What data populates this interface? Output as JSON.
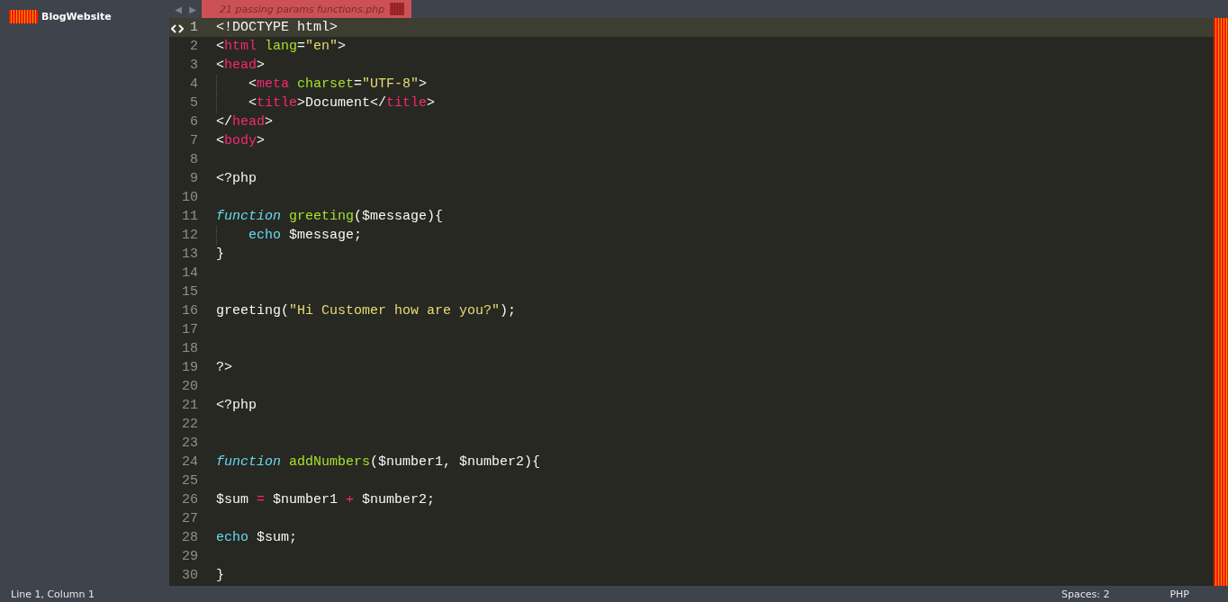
{
  "sidebar": {
    "folders": [
      {
        "name": "BlogWebsite"
      }
    ]
  },
  "tab_bar": {
    "nav": [
      "◀",
      "▶"
    ],
    "tabs": [
      {
        "label": "21 passing params functions.php",
        "selected": true
      }
    ]
  },
  "editor": {
    "lines": [
      {
        "number": "1",
        "current": true,
        "indented": false,
        "tokens": [
          {
            "kind": "plain",
            "text": "<!DOCTYPE html>"
          }
        ]
      },
      {
        "number": "2",
        "current": false,
        "indented": false,
        "tokens": [
          {
            "kind": "plain",
            "text": "<"
          },
          {
            "kind": "tag",
            "text": "html "
          },
          {
            "kind": "attr",
            "text": "lang"
          },
          {
            "kind": "plain",
            "text": "="
          },
          {
            "kind": "string",
            "text": "\"en\""
          },
          {
            "kind": "plain",
            "text": ">"
          }
        ]
      },
      {
        "number": "3",
        "current": false,
        "indented": false,
        "tokens": [
          {
            "kind": "plain",
            "text": "<"
          },
          {
            "kind": "tag",
            "text": "head"
          },
          {
            "kind": "plain",
            "text": ">"
          }
        ]
      },
      {
        "number": "4",
        "current": false,
        "indented": true,
        "tokens": [
          {
            "kind": "plain",
            "text": "<"
          },
          {
            "kind": "tag",
            "text": "meta "
          },
          {
            "kind": "attr",
            "text": "charset"
          },
          {
            "kind": "plain",
            "text": "="
          },
          {
            "kind": "string",
            "text": "\"UTF-8\""
          },
          {
            "kind": "plain",
            "text": ">"
          }
        ]
      },
      {
        "number": "5",
        "current": false,
        "indented": true,
        "tokens": [
          {
            "kind": "plain",
            "text": "<"
          },
          {
            "kind": "tag",
            "text": "title"
          },
          {
            "kind": "plain",
            "text": ">Document</"
          },
          {
            "kind": "tag",
            "text": "title"
          },
          {
            "kind": "plain",
            "text": ">"
          }
        ]
      },
      {
        "number": "6",
        "current": false,
        "indented": false,
        "tokens": [
          {
            "kind": "plain",
            "text": "</"
          },
          {
            "kind": "tag",
            "text": "head"
          },
          {
            "kind": "plain",
            "text": ">"
          }
        ]
      },
      {
        "number": "7",
        "current": false,
        "indented": false,
        "tokens": [
          {
            "kind": "plain",
            "text": "<"
          },
          {
            "kind": "tag",
            "text": "body"
          },
          {
            "kind": "plain",
            "text": ">"
          }
        ]
      },
      {
        "number": "8",
        "current": false,
        "indented": false
      },
      {
        "number": "9",
        "current": false,
        "indented": false,
        "tokens": [
          {
            "kind": "plain",
            "text": "<?php"
          }
        ]
      },
      {
        "number": "10",
        "current": false,
        "indented": false
      },
      {
        "number": "11",
        "current": false,
        "indented": false,
        "tokens": [
          {
            "kind": "storage",
            "text": "function "
          },
          {
            "kind": "entity",
            "text": "greeting"
          },
          {
            "kind": "plain",
            "text": "($message){"
          }
        ]
      },
      {
        "number": "12",
        "current": false,
        "indented": true,
        "tokens": [
          {
            "kind": "builtin",
            "text": "echo"
          },
          {
            "kind": "plain",
            "text": " $message;"
          }
        ]
      },
      {
        "number": "13",
        "current": false,
        "indented": false,
        "tokens": [
          {
            "kind": "plain",
            "text": "}"
          }
        ]
      },
      {
        "number": "14",
        "current": false,
        "indented": false
      },
      {
        "number": "15",
        "current": false,
        "indented": false
      },
      {
        "number": "16",
        "current": false,
        "indented": false,
        "tokens": [
          {
            "kind": "plain",
            "text": "greeting("
          },
          {
            "kind": "string",
            "text": "\"Hi Customer how are you?\""
          },
          {
            "kind": "plain",
            "text": ");"
          }
        ]
      },
      {
        "number": "17",
        "current": false,
        "indented": false
      },
      {
        "number": "18",
        "current": false,
        "indented": false
      },
      {
        "number": "19",
        "current": false,
        "indented": false,
        "tokens": [
          {
            "kind": "plain",
            "text": "?>"
          }
        ]
      },
      {
        "number": "20",
        "current": false,
        "indented": false
      },
      {
        "number": "21",
        "current": false,
        "indented": false,
        "tokens": [
          {
            "kind": "plain",
            "text": "<?php"
          }
        ]
      },
      {
        "number": "22",
        "current": false,
        "indented": false
      },
      {
        "number": "23",
        "current": false,
        "indented": false
      },
      {
        "number": "24",
        "current": false,
        "indented": false,
        "tokens": [
          {
            "kind": "storage",
            "text": "function "
          },
          {
            "kind": "entity",
            "text": "addNumbers"
          },
          {
            "kind": "plain",
            "text": "($number1, $number2){"
          }
        ]
      },
      {
        "number": "25",
        "current": false,
        "indented": false
      },
      {
        "number": "26",
        "current": false,
        "indented": false,
        "tokens": [
          {
            "kind": "plain",
            "text": "$sum "
          },
          {
            "kind": "operator",
            "text": "="
          },
          {
            "kind": "plain",
            "text": " $number1 "
          },
          {
            "kind": "operator",
            "text": "+"
          },
          {
            "kind": "plain",
            "text": " $number2;"
          }
        ]
      },
      {
        "number": "27",
        "current": false,
        "indented": false
      },
      {
        "number": "28",
        "current": false,
        "indented": false,
        "tokens": [
          {
            "kind": "builtin",
            "text": "echo"
          },
          {
            "kind": "plain",
            "text": " $sum;"
          }
        ]
      },
      {
        "number": "29",
        "current": false,
        "indented": false
      },
      {
        "number": "30",
        "current": false,
        "indented": false,
        "tokens": [
          {
            "kind": "plain",
            "text": "}"
          }
        ]
      }
    ]
  },
  "status_bar": {
    "position": "Line 1, Column 1",
    "indentation": "Spaces: 2",
    "syntax": "PHP"
  }
}
